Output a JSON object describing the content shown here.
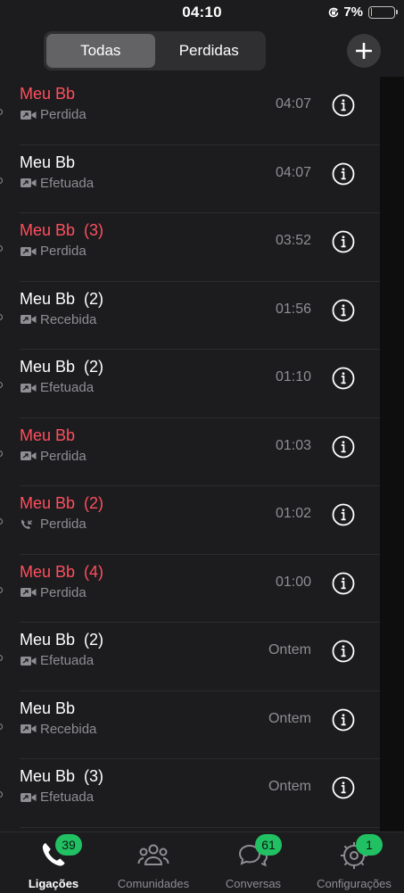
{
  "status_bar": {
    "time": "04:10",
    "battery": "7%",
    "battery_level": 0.07,
    "battery_color": "#f5c400"
  },
  "header": {
    "segments": [
      "Todas",
      "Perdidas"
    ],
    "selected_segment": "Todas",
    "add_icon": "plus-icon"
  },
  "calls": [
    {
      "name": "Meu Bb",
      "missed": true,
      "type_icon": "video-icon",
      "status": "Perdida",
      "time": "04:07"
    },
    {
      "name": "Meu Bb",
      "missed": false,
      "type_icon": "video-icon",
      "status": "Efetuada",
      "time": "04:07"
    },
    {
      "name": "Meu Bb  (3)",
      "missed": true,
      "type_icon": "video-icon",
      "status": "Perdida",
      "time": "03:52"
    },
    {
      "name": "Meu Bb  (2)",
      "missed": false,
      "type_icon": "video-icon",
      "status": "Recebida",
      "time": "01:56"
    },
    {
      "name": "Meu Bb  (2)",
      "missed": false,
      "type_icon": "video-icon",
      "status": "Efetuada",
      "time": "01:10"
    },
    {
      "name": "Meu Bb",
      "missed": true,
      "type_icon": "video-icon",
      "status": "Perdida",
      "time": "01:03"
    },
    {
      "name": "Meu Bb  (2)",
      "missed": true,
      "type_icon": "phone-missed-icon",
      "status": "Perdida",
      "time": "01:02"
    },
    {
      "name": "Meu Bb  (4)",
      "missed": true,
      "type_icon": "video-icon",
      "status": "Perdida",
      "time": "01:00"
    },
    {
      "name": "Meu Bb  (2)",
      "missed": false,
      "type_icon": "video-icon",
      "status": "Efetuada",
      "time": "Ontem"
    },
    {
      "name": "Meu Bb",
      "missed": false,
      "type_icon": "video-icon",
      "status": "Recebida",
      "time": "Ontem"
    },
    {
      "name": "Meu Bb  (3)",
      "missed": false,
      "type_icon": "video-icon",
      "status": "Efetuada",
      "time": "Ontem"
    }
  ],
  "tabs": [
    {
      "label": "Ligações",
      "icon": "phone-icon",
      "badge": "39",
      "active": true
    },
    {
      "label": "Comunidades",
      "icon": "communities-icon",
      "badge": "",
      "active": false
    },
    {
      "label": "Conversas",
      "icon": "chat-icon",
      "badge": "61",
      "active": false
    },
    {
      "label": "Configurações",
      "icon": "gear-icon",
      "badge": "1",
      "active": false
    }
  ],
  "colors": {
    "missed": "#ff4f5e",
    "badge": "#21c063",
    "background": "#1c1c1e"
  }
}
